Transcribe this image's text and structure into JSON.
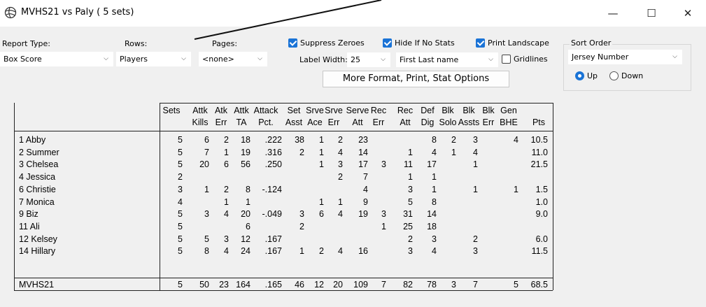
{
  "window": {
    "title": "MVHS21 vs Paly ( 5 sets)",
    "minimize": "—",
    "maximize": "☐",
    "close": "✕"
  },
  "controls": {
    "report_type_label": "Report Type:",
    "report_type_value": "Box Score",
    "rows_label": "Rows:",
    "rows_value": "Players",
    "pages_label": "Pages:",
    "pages_value": "<none>",
    "suppress_zeroes": "Suppress Zeroes",
    "hide_if_no_stats": "Hide If No Stats",
    "print_landscape": "Print Landscape",
    "label_width_label": "Label Width:",
    "label_width_value": "25",
    "name_format_value": "First Last name",
    "gridlines": "Gridlines",
    "more_button": "More Format, Print, Stat Options",
    "sort_order_title": "Sort Order",
    "sort_order_value": "Jersey Number",
    "sort_up": "Up",
    "sort_down": "Down"
  },
  "table": {
    "headers": [
      [
        "Sets",
        ""
      ],
      [
        "Attk",
        "Kills"
      ],
      [
        "Atk",
        "Err"
      ],
      [
        "Attk",
        "TA"
      ],
      [
        "Attack",
        "Pct."
      ],
      [
        "Set",
        "Asst"
      ],
      [
        "Srve",
        "Ace"
      ],
      [
        "Srve",
        "Err"
      ],
      [
        "Serve",
        "Att"
      ],
      [
        "Rec",
        "Err"
      ],
      [
        "Rec",
        "Att"
      ],
      [
        "Def",
        "Dig"
      ],
      [
        "Blk",
        "Solo"
      ],
      [
        "Blk",
        "Assts"
      ],
      [
        "Blk",
        "Err"
      ],
      [
        "Gen",
        "BHE"
      ],
      [
        "",
        "Pts"
      ]
    ],
    "rows": [
      {
        "name": "1 Abby",
        "v": [
          "5",
          "6",
          "2",
          "18",
          ".222",
          "38",
          "1",
          "2",
          "23",
          "",
          "",
          "8",
          "2",
          "3",
          "",
          "4",
          "10.5"
        ]
      },
      {
        "name": "2 Summer",
        "v": [
          "5",
          "7",
          "1",
          "19",
          ".316",
          "2",
          "1",
          "4",
          "14",
          "",
          "1",
          "4",
          "1",
          "4",
          "",
          "",
          "11.0"
        ]
      },
      {
        "name": "3 Chelsea",
        "v": [
          "5",
          "20",
          "6",
          "56",
          ".250",
          "",
          "1",
          "3",
          "17",
          "3",
          "11",
          "17",
          "",
          "1",
          "",
          "",
          "21.5"
        ]
      },
      {
        "name": "4 Jessica",
        "v": [
          "2",
          "",
          "",
          "",
          "",
          "",
          "",
          "2",
          "7",
          "",
          "1",
          "1",
          "",
          "",
          "",
          "",
          ""
        ]
      },
      {
        "name": "6 Christie",
        "v": [
          "3",
          "1",
          "2",
          "8",
          "-.124",
          "",
          "",
          "",
          "4",
          "",
          "3",
          "1",
          "",
          "1",
          "",
          "1",
          "1.5"
        ]
      },
      {
        "name": "7 Monica",
        "v": [
          "4",
          "",
          "1",
          "1",
          "",
          "",
          "1",
          "1",
          "9",
          "",
          "5",
          "8",
          "",
          "",
          "",
          "",
          "1.0"
        ]
      },
      {
        "name": "9 Biz",
        "v": [
          "5",
          "3",
          "4",
          "20",
          "-.049",
          "3",
          "6",
          "4",
          "19",
          "3",
          "31",
          "14",
          "",
          "",
          "",
          "",
          "9.0"
        ]
      },
      {
        "name": "11 Ali",
        "v": [
          "5",
          "",
          "",
          "6",
          "",
          "2",
          "",
          "",
          "",
          "1",
          "25",
          "18",
          "",
          "",
          "",
          "",
          ""
        ]
      },
      {
        "name": "12 Kelsey",
        "v": [
          "5",
          "5",
          "3",
          "12",
          ".167",
          "",
          "",
          "",
          "",
          "",
          "2",
          "3",
          "",
          "2",
          "",
          "",
          "6.0"
        ]
      },
      {
        "name": "14 Hillary",
        "v": [
          "5",
          "8",
          "4",
          "24",
          ".167",
          "1",
          "2",
          "4",
          "16",
          "",
          "3",
          "4",
          "",
          "3",
          "",
          "",
          "11.5"
        ]
      }
    ],
    "total": {
      "name": "MVHS21",
      "v": [
        "5",
        "50",
        "23",
        "164",
        ".165",
        "46",
        "12",
        "20",
        "109",
        "7",
        "82",
        "78",
        "3",
        "7",
        "",
        "5",
        "68.5"
      ]
    }
  }
}
